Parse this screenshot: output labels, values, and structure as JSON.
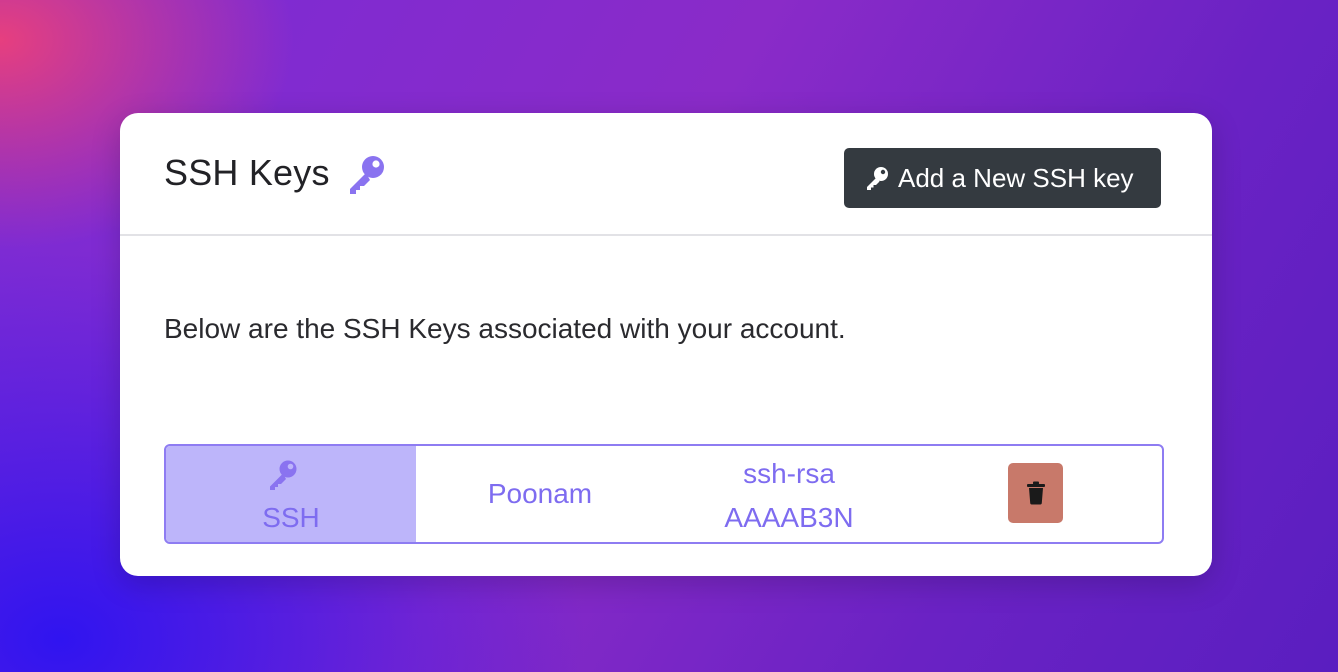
{
  "card": {
    "title": "SSH Keys",
    "title_icon": "key-icon",
    "add_button_label": "Add a New SSH key",
    "add_button_icon": "key-icon",
    "description": "Below are the SSH Keys associated with your account."
  },
  "keys": [
    {
      "type_label": "SSH",
      "type_icon": "key-icon",
      "name": "Poonam",
      "key_line1": "ssh-rsa",
      "key_line2": "AAAAB3N",
      "delete_icon": "trash-icon"
    }
  ],
  "colors": {
    "accent": "#7e6cf0",
    "accent_light": "#bdb5fa",
    "button_dark": "#343a40",
    "delete": "#c8796a"
  }
}
